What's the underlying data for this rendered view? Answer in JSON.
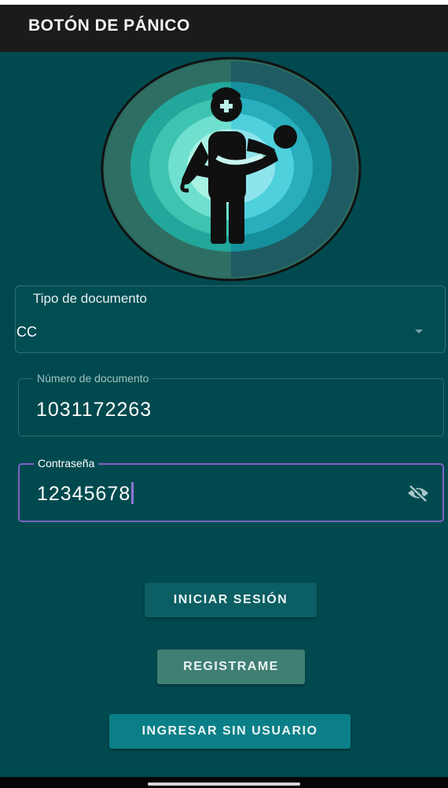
{
  "app_bar": {
    "title": "BOTÓN DE PÁNICO"
  },
  "form": {
    "document_type": {
      "label": "Tipo de documento",
      "value": "CC"
    },
    "document_number": {
      "label": "Número de documento",
      "value": "1031172263"
    },
    "password": {
      "label": "Contraseña",
      "value": "12345678"
    }
  },
  "buttons": {
    "login": "INICIAR SESIÓN",
    "register": "REGISTRAME",
    "guest": "INGRESAR SIN USUARIO"
  },
  "colors": {
    "background": "#004a4f",
    "app_bar": "#1b1b1b",
    "focus_outline": "#7f62c6",
    "login_button": "#0b5e63",
    "register_button": "#3f7f72",
    "guest_button": "#0b7f87"
  },
  "icons": {
    "logo": "rescuer-carrying-person-icon",
    "password_toggle": "eye-off-icon",
    "dropdown": "chevron-down-icon"
  }
}
